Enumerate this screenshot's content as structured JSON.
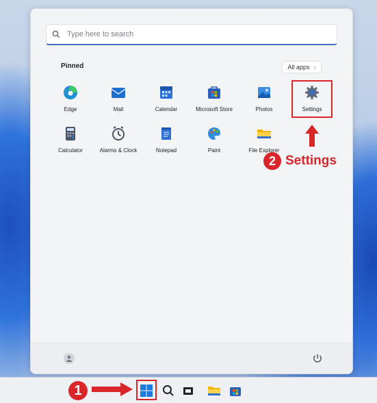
{
  "search": {
    "placeholder": "Type here to search"
  },
  "pinned": {
    "title": "Pinned",
    "all_apps_label": "All apps",
    "apps": [
      {
        "label": "Edge",
        "icon": "edge-icon"
      },
      {
        "label": "Mail",
        "icon": "mail-icon"
      },
      {
        "label": "Calendar",
        "icon": "calendar-icon"
      },
      {
        "label": "Microsoft Store",
        "icon": "store-icon"
      },
      {
        "label": "Photos",
        "icon": "photos-icon"
      },
      {
        "label": "Settings",
        "icon": "gear-icon"
      },
      {
        "label": "Calculator",
        "icon": "calculator-icon"
      },
      {
        "label": "Alarms & Clock",
        "icon": "clock-icon"
      },
      {
        "label": "Notepad",
        "icon": "notepad-icon"
      },
      {
        "label": "Paint",
        "icon": "paint-icon"
      },
      {
        "label": "File Explorer",
        "icon": "folder-icon"
      }
    ]
  },
  "annotations": {
    "step1_number": "1",
    "step2_number": "2",
    "step2_label": "Settings",
    "highlight_color": "#d8262b"
  },
  "taskbar": {
    "icons": [
      "windows-start-icon",
      "search-icon",
      "task-view-icon",
      "file-explorer-icon",
      "store-icon"
    ]
  },
  "colors": {
    "accent": "#3e6fbf",
    "wallpaper_blue": "#2f73dc"
  }
}
